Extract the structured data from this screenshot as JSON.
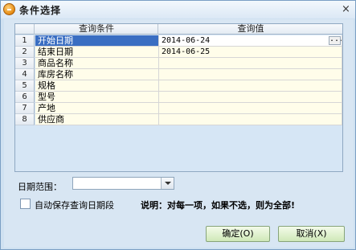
{
  "window": {
    "title": "条件选择",
    "close_glyph": "×"
  },
  "grid": {
    "columns": [
      "查询条件",
      "查询值"
    ],
    "rows": [
      {
        "num": "1",
        "condition": "开始日期",
        "value": "2014-06-24"
      },
      {
        "num": "2",
        "condition": "结束日期",
        "value": "2014-06-25"
      },
      {
        "num": "3",
        "condition": "商品名称",
        "value": ""
      },
      {
        "num": "4",
        "condition": "库房名称",
        "value": ""
      },
      {
        "num": "5",
        "condition": "规格",
        "value": ""
      },
      {
        "num": "6",
        "condition": "型号",
        "value": ""
      },
      {
        "num": "7",
        "condition": "产地",
        "value": ""
      },
      {
        "num": "8",
        "condition": "供应商",
        "value": ""
      }
    ],
    "ellipsis_glyph": "..."
  },
  "date_range": {
    "label": "日期范围：",
    "value": ""
  },
  "autosave": {
    "label": "自动保存查询日期段",
    "checked": false
  },
  "note": "说明：对每一项，如果不选，则为全部!",
  "buttons": {
    "ok": "确定(O)",
    "cancel": "取消(X)"
  },
  "colors": {
    "selected_row": "#3a6ec2",
    "cell_background": "#fffdea",
    "window_background": "#d8e6f3"
  }
}
